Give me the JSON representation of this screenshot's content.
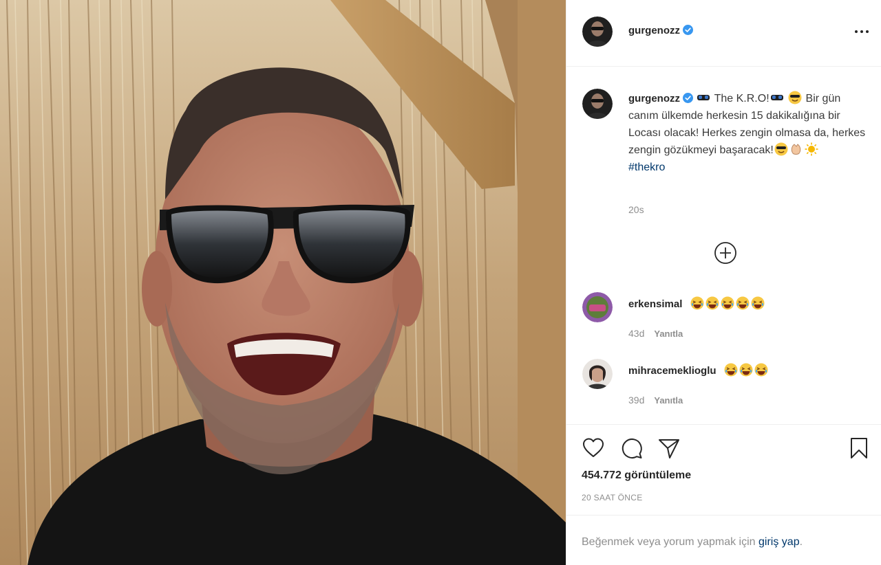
{
  "post": {
    "username": "gurgenozz",
    "verified": true,
    "more_icon": "more-horizontal-icon"
  },
  "caption": {
    "username": "gurgenozz",
    "title": "The K.R.O!",
    "text": "Bir gün canım ülkemde herkesin 15 dakikalığına bir Locası olacak! Herkes zengin olmasa da, herkes zengin gözükmeyi başaracak!",
    "hashtag": "#thekro",
    "age": "20s"
  },
  "comments": [
    {
      "username": "erkensimal",
      "emoji_count": 5,
      "age": "43d",
      "reply": "Yanıtla"
    },
    {
      "username": "mihracemeklioglu",
      "emoji_count": 3,
      "age": "39d",
      "reply": "Yanıtla"
    }
  ],
  "actions": {
    "views": "454.772 görüntüleme",
    "time": "20 SAAT ÖNCE"
  },
  "login": {
    "prefix": "Beğenmek veya yorum yapmak için",
    "link": "giriş yap",
    "suffix": "."
  },
  "colors": {
    "verified": "#3897f0",
    "link": "#00376b",
    "muted": "#8e8e8e",
    "border": "#efefef"
  }
}
